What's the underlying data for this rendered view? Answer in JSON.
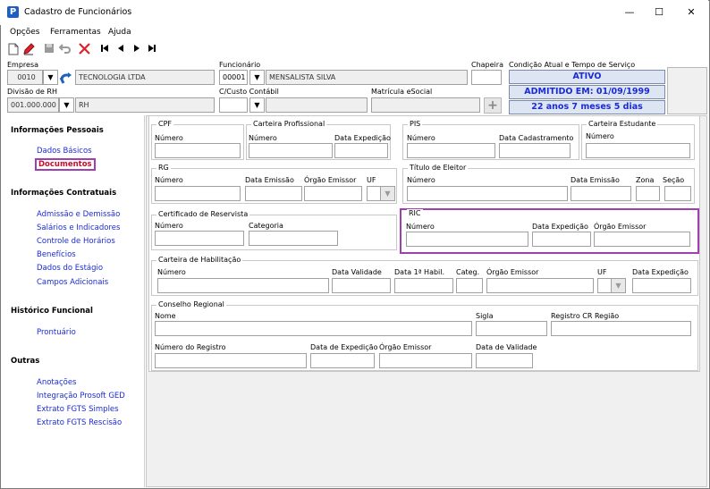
{
  "window": {
    "title": "Cadastro de Funcionários",
    "icon_letter": "P",
    "minimize": "—",
    "maximize": "☐",
    "close": "✕"
  },
  "menu": [
    "Opções",
    "Ferramentas",
    "Ajuda"
  ],
  "toolbar": [
    "new-icon",
    "edit-icon",
    "save-icon",
    "undo-icon",
    "delete-icon",
    "first-icon",
    "prev-icon",
    "next-icon",
    "last-icon"
  ],
  "header": {
    "empresa_label": "Empresa",
    "empresa_code": "0010",
    "empresa_name": "TECNOLOGIA LTDA",
    "funcionario_label": "Funcionário",
    "funcionario_code": "00001",
    "funcionario_name": "MENSALISTA SILVA",
    "chapeira_label": "Chapeira",
    "chapeira_value": "",
    "condicao_label": "Condição Atual e Tempo de Serviço",
    "status": "ATIVO",
    "admitido": "ADMITIDO EM: 01/09/1999",
    "tempo": "22 anos 7 meses 5 dias",
    "divisao_label": "Divisão de RH",
    "divisao_code": "001.000.000",
    "divisao_name": "RH",
    "ccusto_label": "C/Custo Contábil",
    "matricula_label": "Matrícula eSocial",
    "plus": "+"
  },
  "sidebar": {
    "sections": [
      {
        "title": "Informações Pessoais",
        "items": [
          "Dados Básicos",
          "Documentos"
        ]
      },
      {
        "title": "Informações Contratuais",
        "items": [
          "Admissão e Demissão",
          "Salários e Indicadores",
          "Controle de Horários",
          "Benefícios",
          "Dados do Estágio",
          "Campos Adicionais"
        ]
      },
      {
        "title": "Histórico Funcional",
        "items": [
          "Prontuário"
        ]
      },
      {
        "title": "Outras",
        "items": [
          "Anotações",
          "Integração Prosoft GED",
          "Extrato FGTS Simples",
          "Extrato FGTS Rescisão"
        ]
      }
    ],
    "active": "Documentos"
  },
  "docs": {
    "cpf": {
      "title": "CPF",
      "numero": "Número"
    },
    "ctps": {
      "title": "Carteira Profissional",
      "numero": "Número",
      "data_expedicao": "Data Expedição"
    },
    "pis": {
      "title": "PIS",
      "numero": "Número",
      "data_cadastramento": "Data Cadastramento"
    },
    "estudante": {
      "title": "Carteira Estudante",
      "numero": "Número"
    },
    "rg": {
      "title": "RG",
      "numero": "Número",
      "data_emissao": "Data Emissão",
      "orgao_emissor": "Órgão Emissor",
      "uf": "UF"
    },
    "eleitor": {
      "title": "Título de Eleitor",
      "numero": "Número",
      "data_emissao": "Data Emissão",
      "zona": "Zona",
      "secao": "Seção"
    },
    "reservista": {
      "title": "Certificado de Reservista",
      "numero": "Número",
      "categoria": "Categoria"
    },
    "ric": {
      "title": "RIC",
      "numero": "Número",
      "data_expedicao": "Data Expedição",
      "orgao_emissor": "Órgão Emissor"
    },
    "habilitacao": {
      "title": "Carteira de Habilitação",
      "numero": "Número",
      "data_validade": "Data Validade",
      "data_1a": "Data 1ª Habil.",
      "categ": "Categ.",
      "orgao_emissor": "Órgão Emissor",
      "uf": "UF",
      "data_expedicao": "Data Expedição"
    },
    "conselho": {
      "title": "Conselho Regional",
      "nome": "Nome",
      "sigla": "Sigla",
      "registro_cr": "Registro CR Região",
      "numero_registro": "Número do Registro",
      "data_expedicao": "Data de Expedição",
      "orgao_emissor": "Órgão Emissor",
      "data_validade": "Data de Validade"
    }
  }
}
